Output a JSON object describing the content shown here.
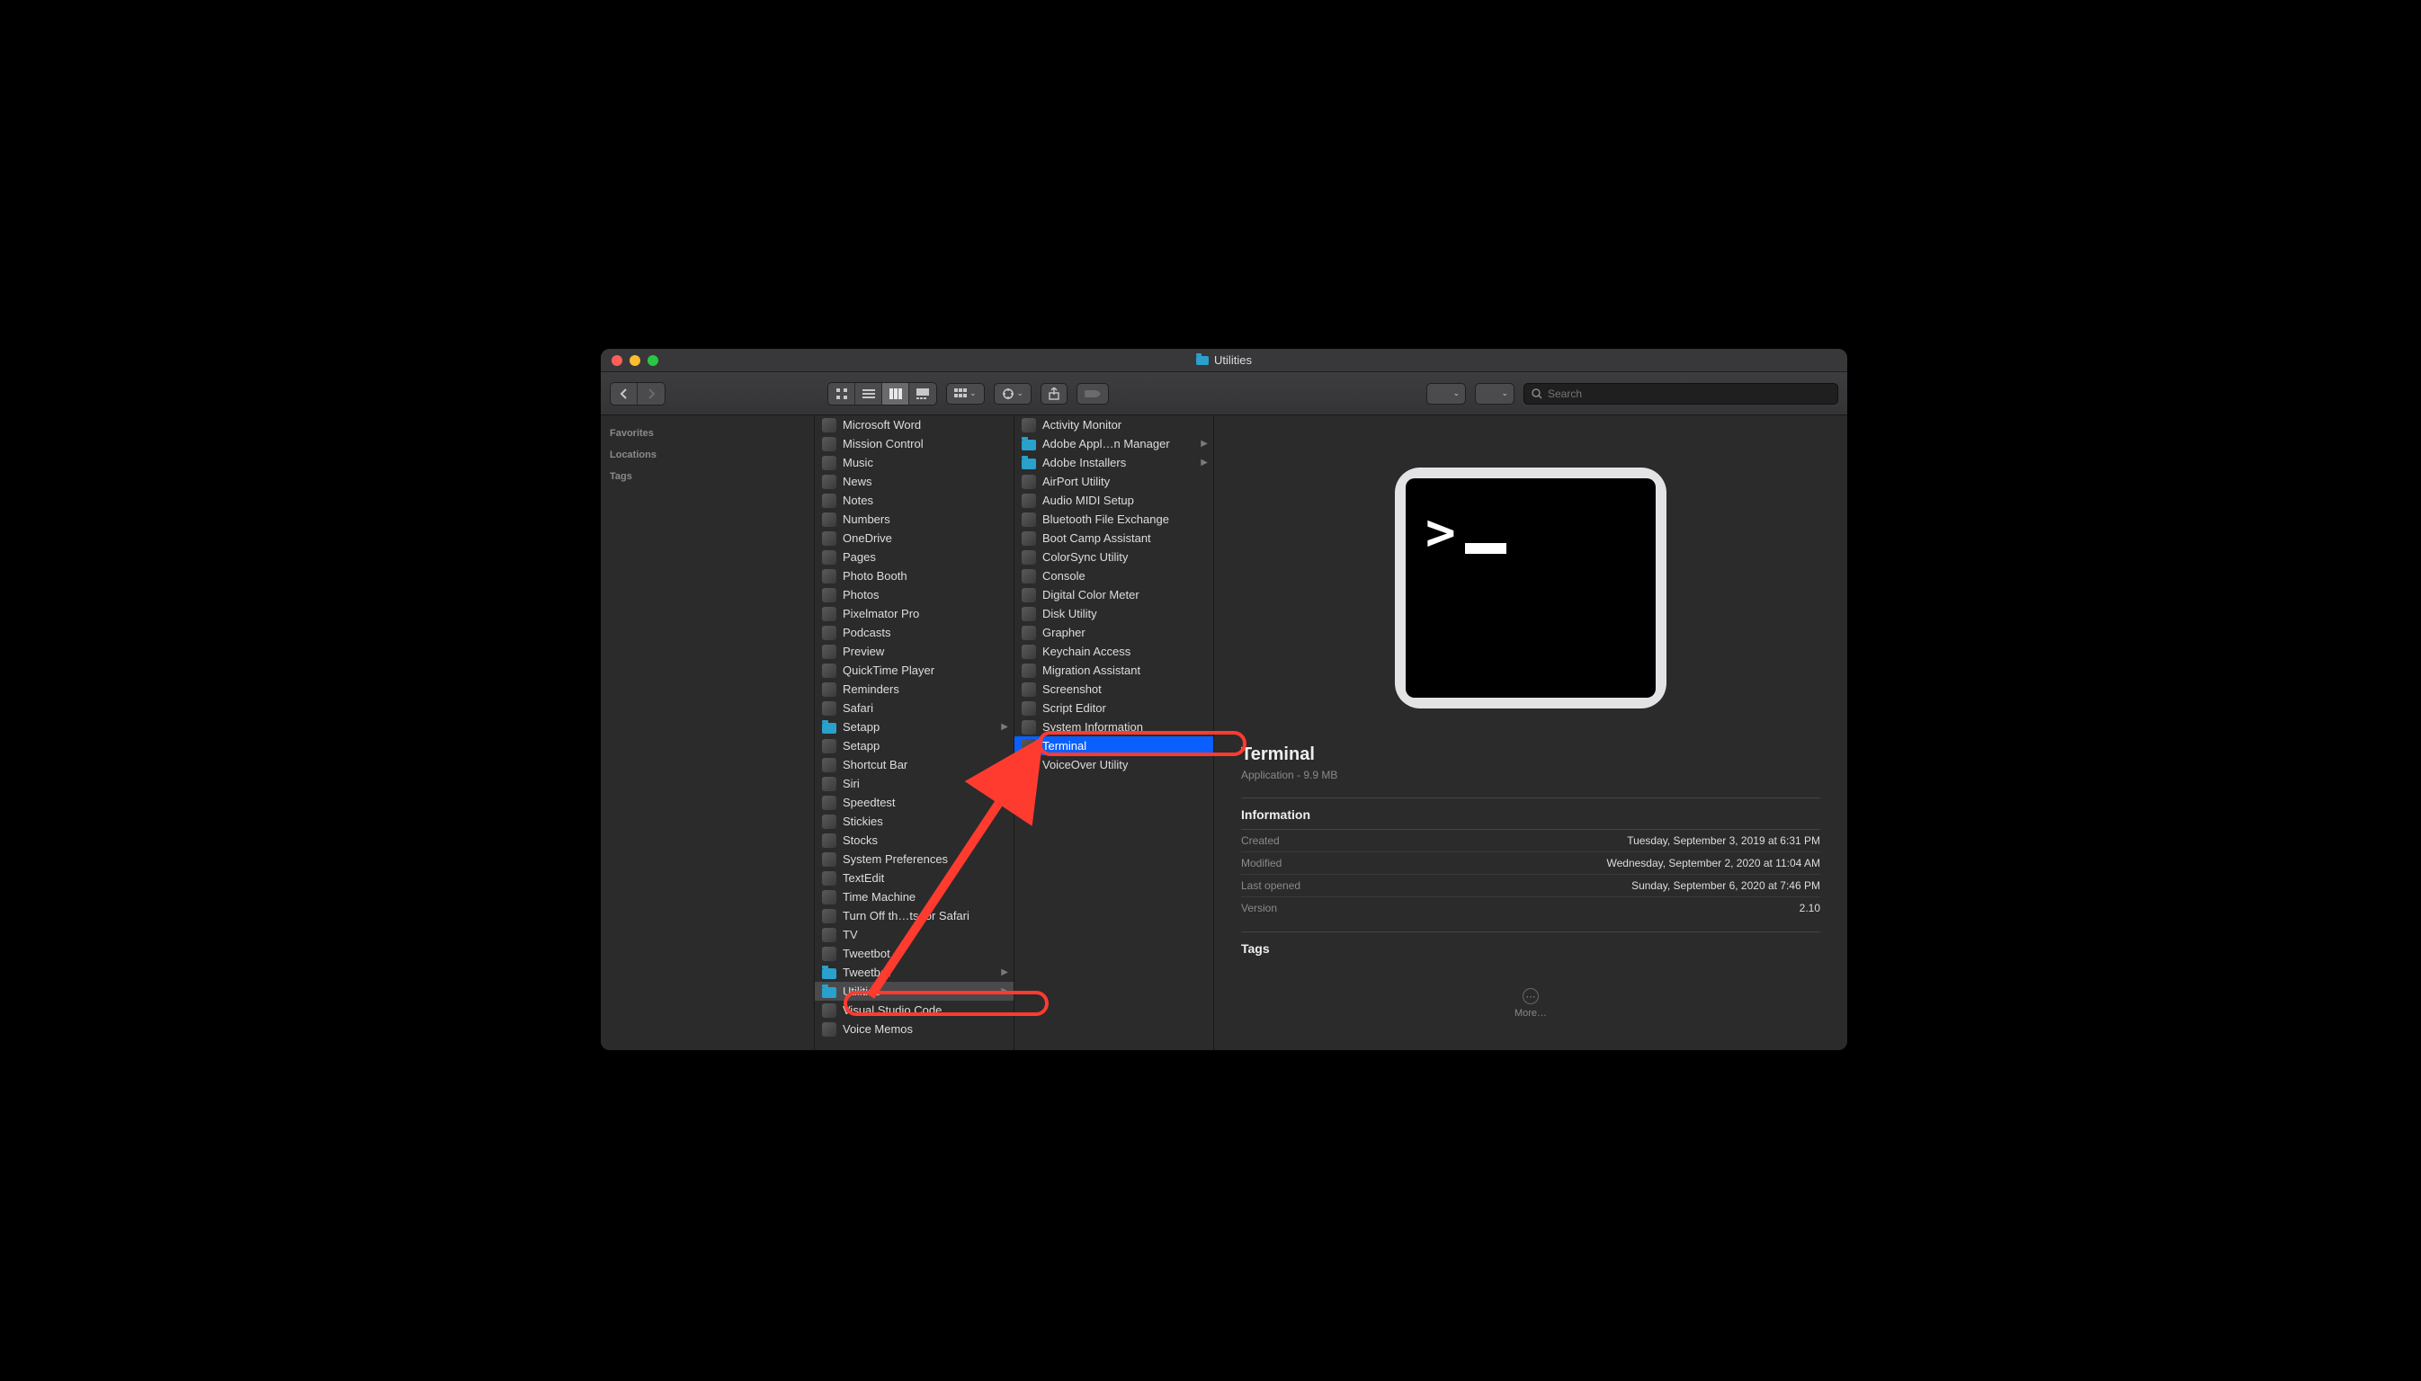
{
  "window": {
    "title": "Utilities"
  },
  "toolbar": {
    "search_placeholder": "Search"
  },
  "sidebar": {
    "headers": [
      "Favorites",
      "Locations",
      "Tags"
    ]
  },
  "col_apps": [
    {
      "label": "Microsoft Word",
      "kind": "app"
    },
    {
      "label": "Mission Control",
      "kind": "app"
    },
    {
      "label": "Music",
      "kind": "app"
    },
    {
      "label": "News",
      "kind": "app"
    },
    {
      "label": "Notes",
      "kind": "app"
    },
    {
      "label": "Numbers",
      "kind": "app"
    },
    {
      "label": "OneDrive",
      "kind": "app"
    },
    {
      "label": "Pages",
      "kind": "app"
    },
    {
      "label": "Photo Booth",
      "kind": "app"
    },
    {
      "label": "Photos",
      "kind": "app"
    },
    {
      "label": "Pixelmator Pro",
      "kind": "app"
    },
    {
      "label": "Podcasts",
      "kind": "app"
    },
    {
      "label": "Preview",
      "kind": "app"
    },
    {
      "label": "QuickTime Player",
      "kind": "app"
    },
    {
      "label": "Reminders",
      "kind": "app"
    },
    {
      "label": "Safari",
      "kind": "app"
    },
    {
      "label": "Setapp",
      "kind": "folder",
      "disclosure": true
    },
    {
      "label": "Setapp",
      "kind": "app"
    },
    {
      "label": "Shortcut Bar",
      "kind": "app"
    },
    {
      "label": "Siri",
      "kind": "app"
    },
    {
      "label": "Speedtest",
      "kind": "app"
    },
    {
      "label": "Stickies",
      "kind": "app"
    },
    {
      "label": "Stocks",
      "kind": "app"
    },
    {
      "label": "System Preferences",
      "kind": "app"
    },
    {
      "label": "TextEdit",
      "kind": "app"
    },
    {
      "label": "Time Machine",
      "kind": "app"
    },
    {
      "label": "Turn Off th…ts for Safari",
      "kind": "app"
    },
    {
      "label": "TV",
      "kind": "app"
    },
    {
      "label": "Tweetbot",
      "kind": "app"
    },
    {
      "label": "Tweetbot",
      "kind": "folder",
      "disclosure": true
    },
    {
      "label": "Utilities",
      "kind": "folder",
      "disclosure": true,
      "selected": "gray"
    },
    {
      "label": "Visual Studio Code",
      "kind": "app"
    },
    {
      "label": "Voice Memos",
      "kind": "app"
    }
  ],
  "col_utils": [
    {
      "label": "Activity Monitor",
      "kind": "app"
    },
    {
      "label": "Adobe Appl…n Manager",
      "kind": "folder",
      "disclosure": true
    },
    {
      "label": "Adobe Installers",
      "kind": "folder",
      "disclosure": true
    },
    {
      "label": "AirPort Utility",
      "kind": "app"
    },
    {
      "label": "Audio MIDI Setup",
      "kind": "app"
    },
    {
      "label": "Bluetooth File Exchange",
      "kind": "app"
    },
    {
      "label": "Boot Camp Assistant",
      "kind": "app"
    },
    {
      "label": "ColorSync Utility",
      "kind": "app"
    },
    {
      "label": "Console",
      "kind": "app"
    },
    {
      "label": "Digital Color Meter",
      "kind": "app"
    },
    {
      "label": "Disk Utility",
      "kind": "app"
    },
    {
      "label": "Grapher",
      "kind": "app"
    },
    {
      "label": "Keychain Access",
      "kind": "app"
    },
    {
      "label": "Migration Assistant",
      "kind": "app"
    },
    {
      "label": "Screenshot",
      "kind": "app"
    },
    {
      "label": "Script Editor",
      "kind": "app"
    },
    {
      "label": "System Information",
      "kind": "app"
    },
    {
      "label": "Terminal",
      "kind": "app",
      "selected": "blue"
    },
    {
      "label": "VoiceOver Utility",
      "kind": "app"
    }
  ],
  "preview": {
    "name": "Terminal",
    "subtitle": "Application - 9.9 MB",
    "section_info": "Information",
    "rows": [
      {
        "k": "Created",
        "v": "Tuesday, September 3, 2019 at 6:31 PM"
      },
      {
        "k": "Modified",
        "v": "Wednesday, September 2, 2020 at 11:04 AM"
      },
      {
        "k": "Last opened",
        "v": "Sunday, September 6, 2020 at 7:46 PM"
      },
      {
        "k": "Version",
        "v": "2.10"
      }
    ],
    "section_tags": "Tags",
    "more_label": "More…"
  }
}
